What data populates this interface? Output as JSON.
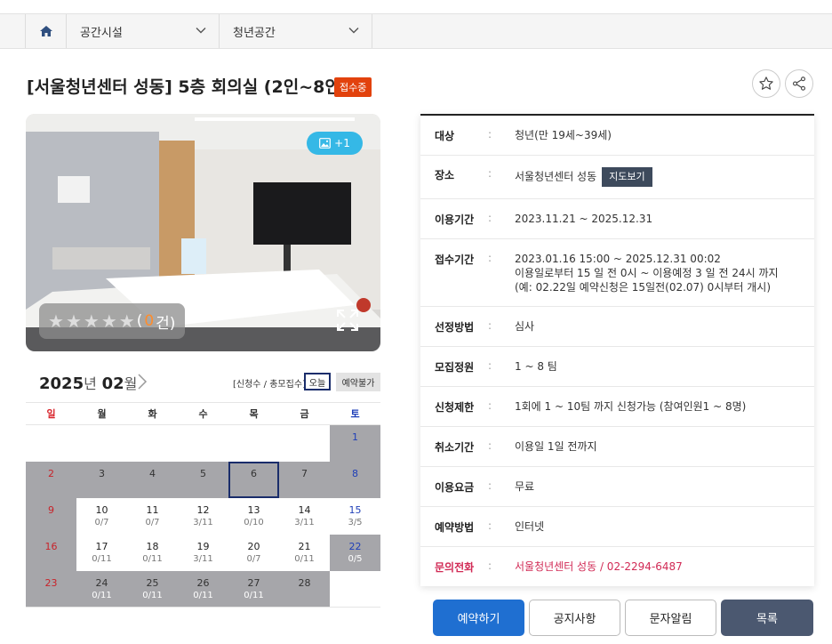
{
  "breadcrumb": {
    "level1": "공간시설",
    "level2": "청년공간"
  },
  "title": "[서울청년센터 성동] 5층 회의실 (2인~8인)",
  "status_badge": "접수중",
  "photo": {
    "image_count": "+1",
    "rating_count_prefix": "(",
    "rating_count": "0",
    "rating_count_suffix": " 건)"
  },
  "calendar": {
    "year": "2025",
    "year_unit": "년",
    "month": "02",
    "month_unit": "월",
    "legend": "[신청수 / 총모집수]",
    "today_label": "오늘",
    "unavailable_label": "예약불가",
    "weekdays": [
      "일",
      "월",
      "화",
      "수",
      "목",
      "금",
      "토"
    ],
    "rows": [
      [
        {
          "d": "",
          "s": "e"
        },
        {
          "d": "",
          "s": "e"
        },
        {
          "d": "",
          "s": "e"
        },
        {
          "d": "",
          "s": "e"
        },
        {
          "d": "",
          "s": "e"
        },
        {
          "d": "",
          "s": "e"
        },
        {
          "d": "1",
          "s": "g"
        }
      ],
      [
        {
          "d": "2",
          "s": "g"
        },
        {
          "d": "3",
          "s": "g"
        },
        {
          "d": "4",
          "s": "g"
        },
        {
          "d": "5",
          "s": "g"
        },
        {
          "d": "6",
          "s": "g",
          "today": true
        },
        {
          "d": "7",
          "s": "g"
        },
        {
          "d": "8",
          "s": "g"
        }
      ],
      [
        {
          "d": "9",
          "s": "g"
        },
        {
          "d": "10",
          "r": "0/7",
          "s": "w"
        },
        {
          "d": "11",
          "r": "0/7",
          "s": "w"
        },
        {
          "d": "12",
          "r": "3/11",
          "s": "w"
        },
        {
          "d": "13",
          "r": "0/10",
          "s": "w"
        },
        {
          "d": "14",
          "r": "3/11",
          "s": "w"
        },
        {
          "d": "15",
          "r": "3/5",
          "s": "w"
        }
      ],
      [
        {
          "d": "16",
          "s": "g"
        },
        {
          "d": "17",
          "r": "0/11",
          "s": "w"
        },
        {
          "d": "18",
          "r": "0/11",
          "s": "w"
        },
        {
          "d": "19",
          "r": "3/11",
          "s": "w"
        },
        {
          "d": "20",
          "r": "0/7",
          "s": "w"
        },
        {
          "d": "21",
          "r": "0/11",
          "s": "w"
        },
        {
          "d": "22",
          "r": "0/5",
          "s": "g"
        }
      ],
      [
        {
          "d": "23",
          "s": "g"
        },
        {
          "d": "24",
          "r": "0/11",
          "s": "g"
        },
        {
          "d": "25",
          "r": "0/11",
          "s": "g"
        },
        {
          "d": "26",
          "r": "0/11",
          "s": "g"
        },
        {
          "d": "27",
          "r": "0/11",
          "s": "g"
        },
        {
          "d": "28",
          "s": "g"
        },
        {
          "d": "",
          "s": "e"
        }
      ]
    ]
  },
  "info": {
    "target_label": "대상",
    "target": "청년(만 19세~39세)",
    "place_label": "장소",
    "place": "서울청년센터 성동",
    "map_button": "지도보기",
    "period_label": "이용기간",
    "period": "2023.11.21 ~ 2025.12.31",
    "reception_label": "접수기간",
    "reception_1": "2023.01.16 15:00 ~ 2025.12.31 00:02",
    "reception_2": "이용일로부터 15 일 전 0시 ~ 이용예정 3 일 전 24시 까지",
    "reception_3": "(예: 02.22일 예약신청은 15일전(02.07) 0시부터 개시)",
    "selection_label": "선정방법",
    "selection": "심사",
    "capacity_label": "모집정원",
    "capacity": "1 ~ 8 팀",
    "limit_label": "신청제한",
    "limit": "1회에 1 ~ 10팀 까지 신청가능 (참여인원1 ~ 8명)",
    "cancel_label": "취소기간",
    "cancel": "이용일 1일 전까지",
    "fee_label": "이용요금",
    "fee": "무료",
    "method_label": "예약방법",
    "method": "인터넷",
    "contact_label": "문의전화",
    "contact": "서울청년센터 성동 / 02-2294-6487"
  },
  "buttons": {
    "reserve": "예약하기",
    "notice": "공지사항",
    "sms": "문자알림",
    "list": "목록"
  },
  "colors": {
    "badge": "#e2420d",
    "primary": "#1f6fd1",
    "dark_button": "#4b5870",
    "contact": "#d12a55",
    "closed_day": "#a6a6aa"
  }
}
